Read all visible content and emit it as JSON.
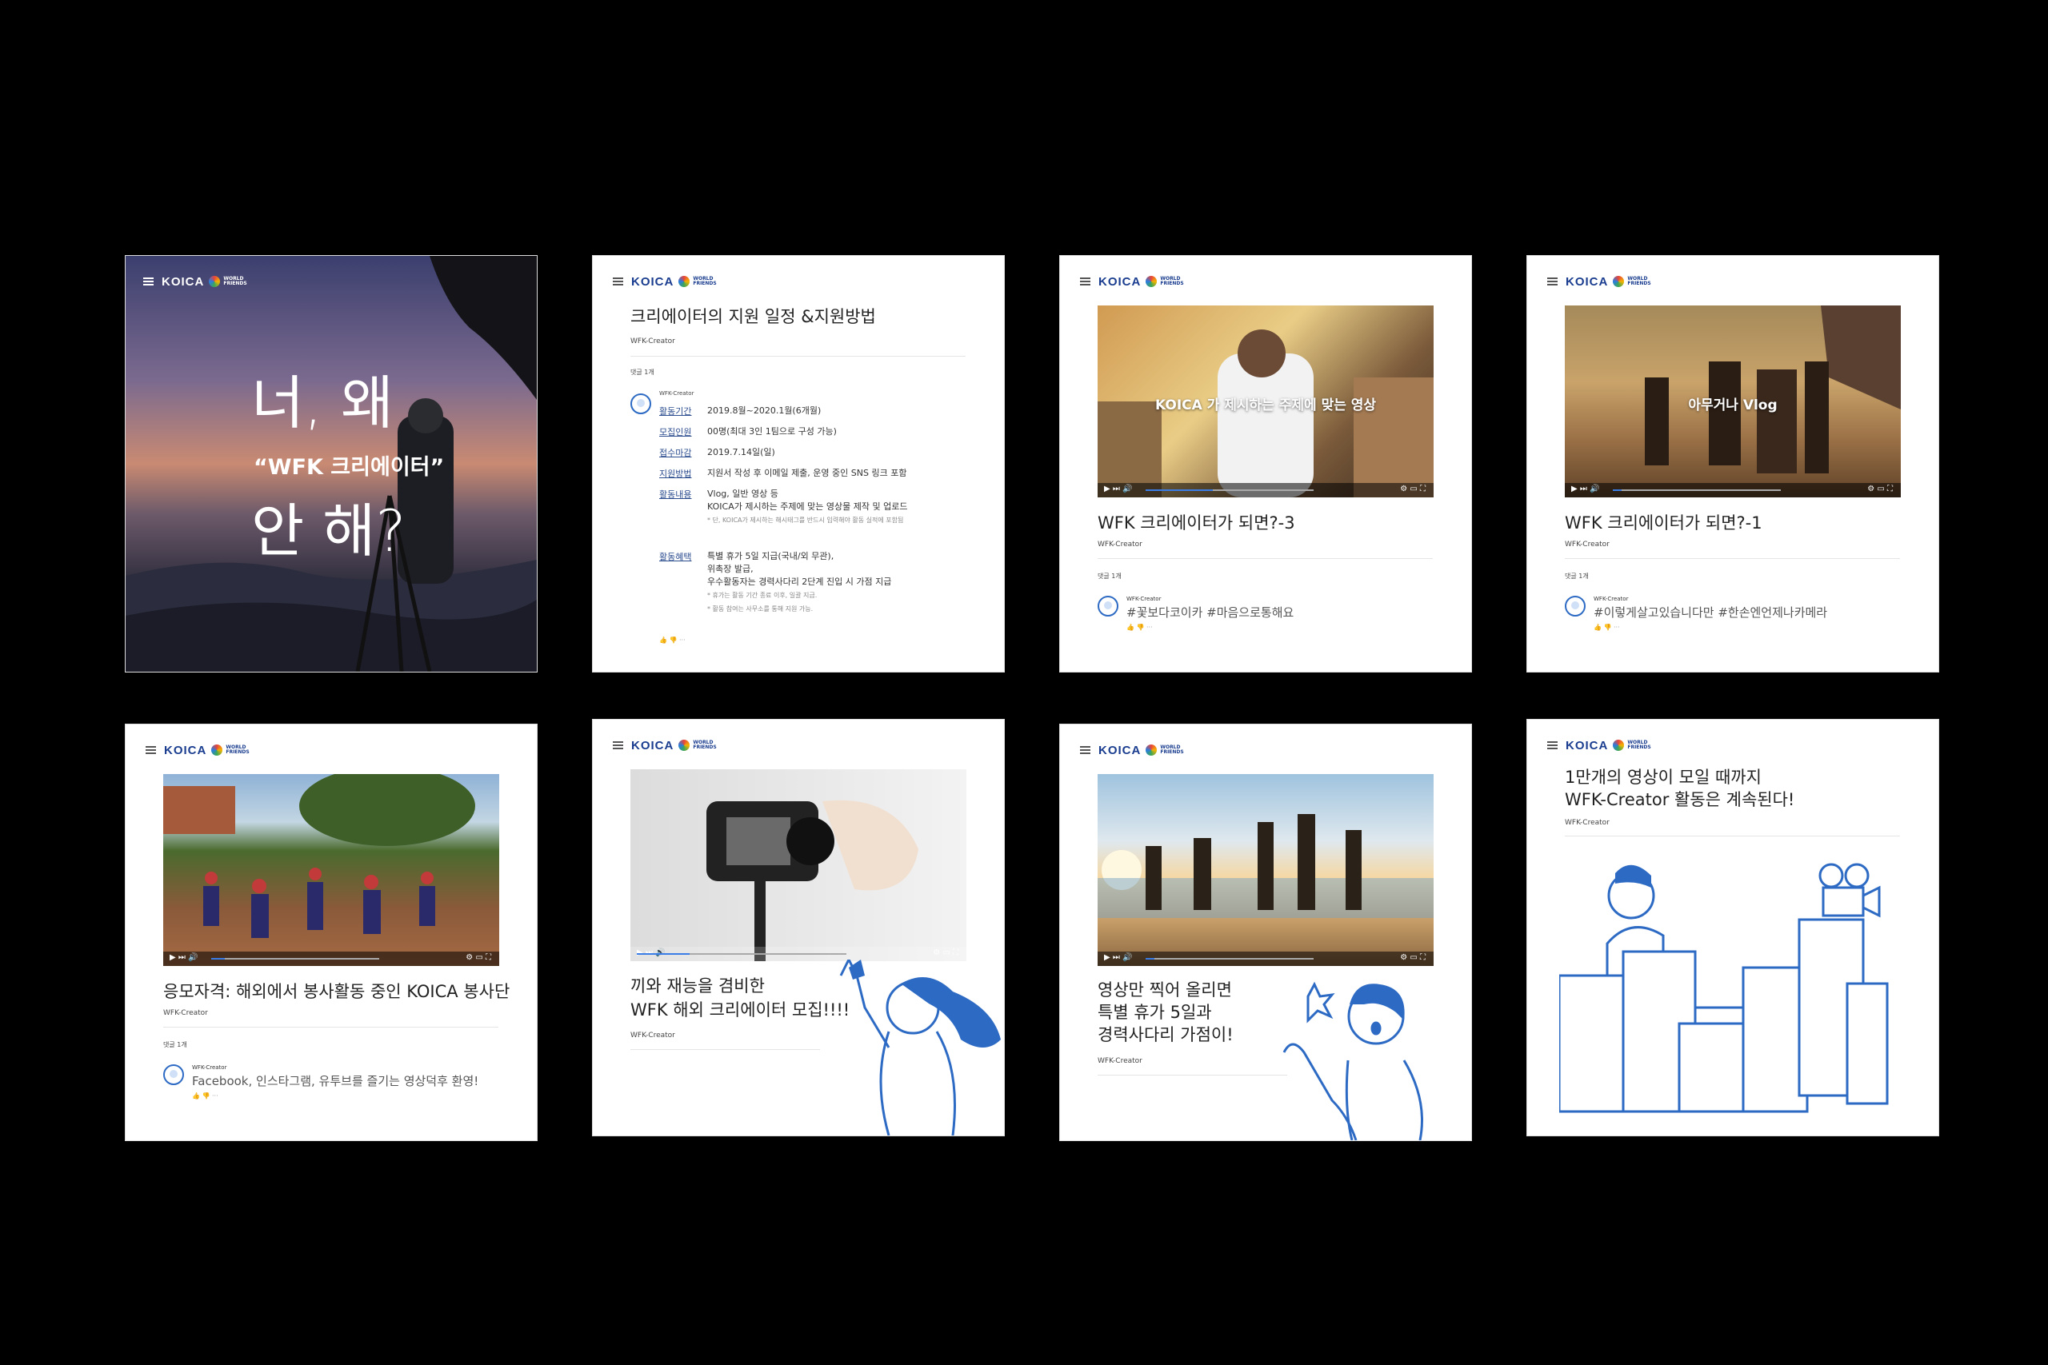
{
  "brand": {
    "logo": "KOICA",
    "wf_line1": "WORLD",
    "wf_line2": "FRIENDS",
    "menu_icon": "menu-icon"
  },
  "card1": {
    "line1": "너, 왜",
    "line2": "“WFK 크리에이터”",
    "line3": "안 해?"
  },
  "card2": {
    "title": "크리에이터의 지원 일정 &지원방법",
    "author": "WFK-Creator",
    "comment_count": "댓글 1개",
    "commenter": "WFK-Creator",
    "rows": [
      {
        "label": "활동기간",
        "value": "2019.8월~2020.1월(6개월)"
      },
      {
        "label": "모집인원",
        "value": "00명(최대 3인 1팀으로 구성 가능)"
      },
      {
        "label": "접수마감",
        "value": "2019.7.14일(일)"
      },
      {
        "label": "지원방법",
        "value": "지원서 작성 후 이메일 제출, 운영 중인 SNS 링크 포함"
      },
      {
        "label": "활동내용",
        "value": "Vlog, 일반 영상 등",
        "value2": "KOICA가 제시하는 주제에 맞는 영상물 제작 및 업로드",
        "note": "* 단, KOICA가 제시하는 해시태그를 반드시 입력해야 활동 실적에 포함됨"
      },
      {
        "label": "활동혜택",
        "value": "특별 휴가 5일 지급(국내/외 무관),",
        "value2": "위촉장 발급,",
        "value3": "우수활동자는 경력사다리 2단계 진입 시 가점 지급",
        "note": "* 휴가는 활동 기간 종료 이후, 일괄 지급.",
        "note2": "* 활동 참여는 사무소를 통해 지원 가능."
      }
    ]
  },
  "card3": {
    "overlay": "KOICA 가 제시하는 주제에 맞는 영상",
    "title": "WFK 크리에이터가 되면?-3",
    "author": "WFK-Creator",
    "comment_count": "댓글 1개",
    "commenter": "WFK-Creator",
    "comment": "#꽃보다코이카  #마음으로통해요"
  },
  "card4": {
    "overlay": "아무거나 Vlog",
    "title": "WFK 크리에이터가 되면?-1",
    "author": "WFK-Creator",
    "comment_count": "댓글 1개",
    "commenter": "WFK-Creator",
    "comment": "#이렇게살고있습니다만  #한손엔언제나카메라"
  },
  "card5": {
    "title": "응모자격: 해외에서 봉사활동 중인 KOICA 봉사단",
    "author": "WFK-Creator",
    "comment_count": "댓글 1개",
    "commenter": "WFK-Creator",
    "comment": "Facebook, 인스타그램, 유투브를 즐기는 영상덕후 환영!"
  },
  "card6": {
    "title1": "끼와 재능을 겸비한",
    "title2": "WFK 해외 크리에이터 모집!!!!",
    "author": "WFK-Creator"
  },
  "card7": {
    "title1": "영상만 찍어 올리면",
    "title2": "특별 휴가 5일과",
    "title3": "경력사다리 가점이!",
    "author": "WFK-Creator"
  },
  "card8": {
    "title1": "1만개의 영상이 모일 때까지",
    "title2": "WFK-Creator 활동은 계속된다!",
    "author": "WFK-Creator"
  },
  "colors": {
    "brand_blue": "#1a3d8f",
    "illustration_blue": "#2d6ac4",
    "background": "#000000"
  }
}
